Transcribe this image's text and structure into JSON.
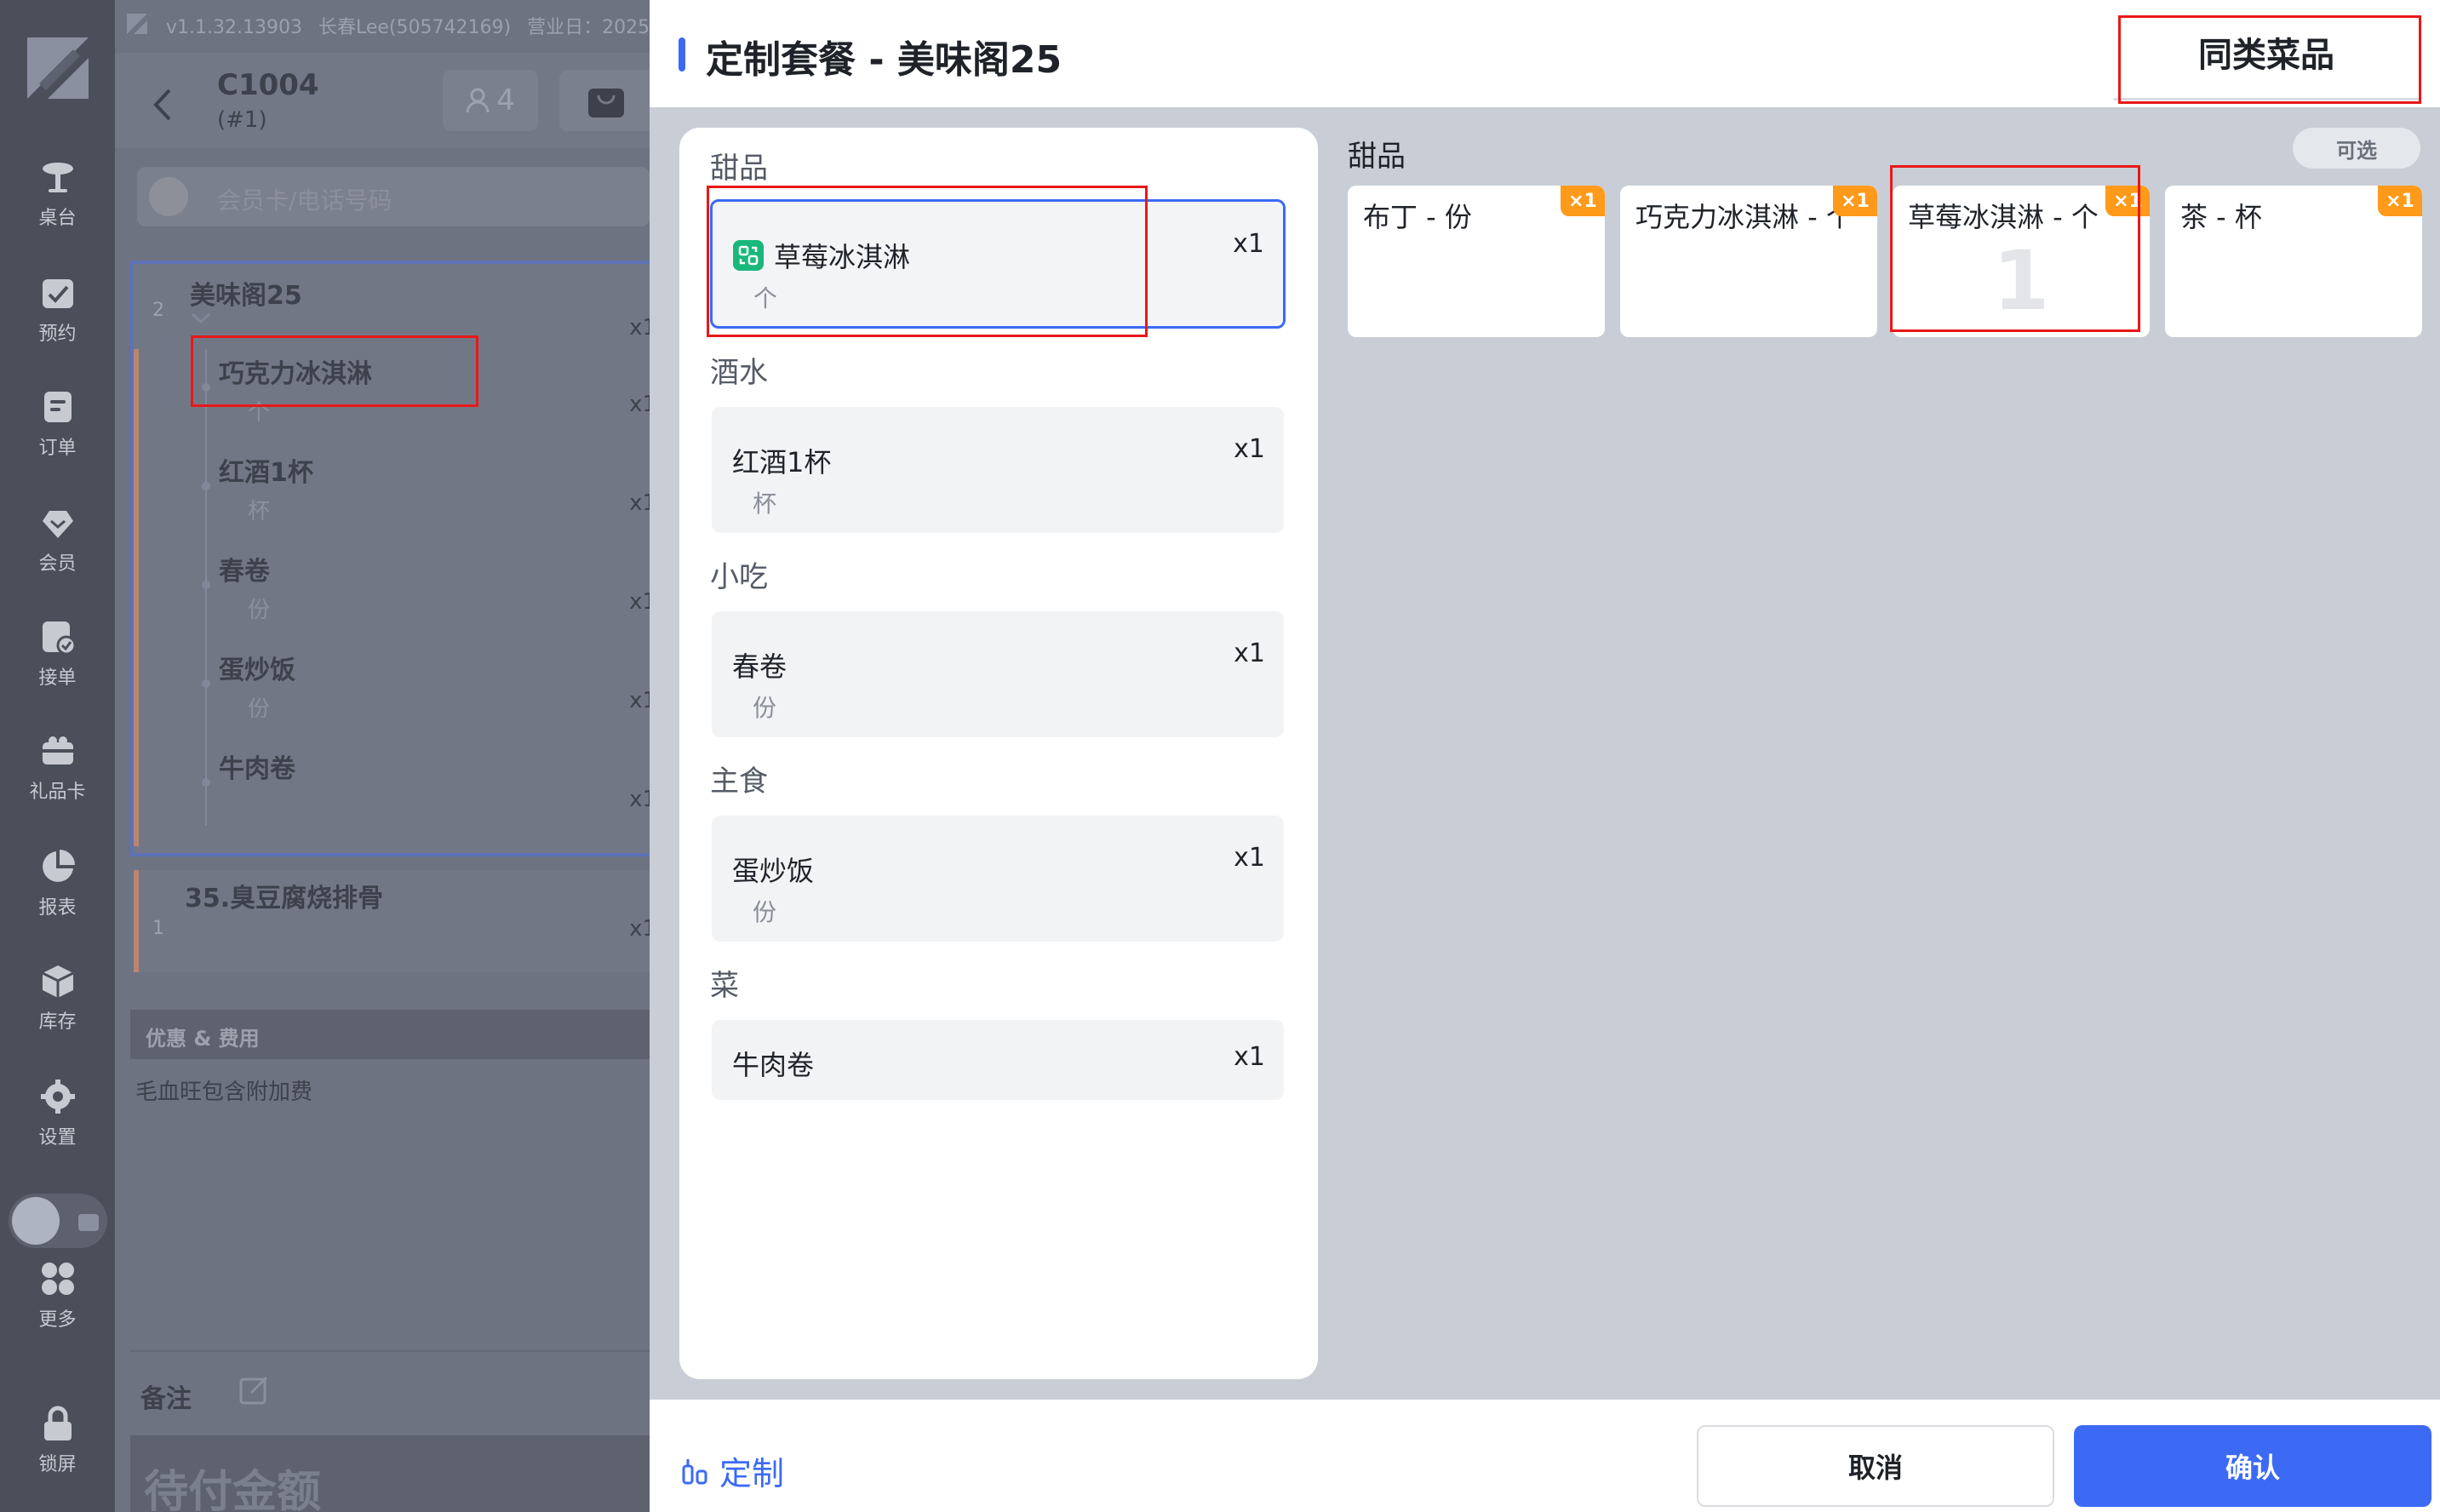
{
  "app": {
    "version": "v1.1.32.13903",
    "user": "长春Lee(505742169)",
    "business_day_label": "营业日：2025"
  },
  "nav": [
    {
      "label": "桌台",
      "icon": "table-icon"
    },
    {
      "label": "预约",
      "icon": "reservation-icon"
    },
    {
      "label": "订单",
      "icon": "order-icon"
    },
    {
      "label": "会员",
      "icon": "member-icon"
    },
    {
      "label": "接单",
      "icon": "accept-order-icon"
    },
    {
      "label": "礼品卡",
      "icon": "gift-card-icon"
    },
    {
      "label": "报表",
      "icon": "report-icon"
    },
    {
      "label": "库存",
      "icon": "inventory-icon"
    },
    {
      "label": "设置",
      "icon": "settings-icon"
    },
    {
      "label": "更多",
      "icon": "more-icon"
    },
    {
      "label": "锁屏",
      "icon": "lock-icon"
    }
  ],
  "order": {
    "table_no": "C1004",
    "table_sub": "(#1)",
    "guests": "4",
    "member_placeholder": "会员卡/电话号码",
    "combo": {
      "count": "2",
      "title": "美味阁25",
      "qty": "x1",
      "items": [
        {
          "name": "巧克力冰淇淋",
          "unit": "个",
          "qty": "x1"
        },
        {
          "name": "红酒1杯",
          "unit": "杯",
          "qty": "x1"
        },
        {
          "name": "春卷",
          "unit": "份",
          "qty": "x1"
        },
        {
          "name": "蛋炒饭",
          "unit": "份",
          "qty": "x1"
        },
        {
          "name": "牛肉卷",
          "unit": "",
          "qty": "x1"
        }
      ]
    },
    "item2": {
      "count": "1",
      "name": "35.臭豆腐烧排骨",
      "qty": "x1"
    },
    "discount_label": "优惠 & 费用",
    "surcharge": "毛血旺包含附加费",
    "remark_label": "备注",
    "pay_label": "待付金额"
  },
  "modal": {
    "title": "定制套餐 - 美味阁25",
    "similar_button": "同类菜品",
    "groups": [
      {
        "title": "甜品",
        "dish": {
          "name": "草莓冰淇淋",
          "unit": "个",
          "qty": "x1"
        }
      },
      {
        "title": "酒水",
        "dish": {
          "name": "红酒1杯",
          "unit": "杯",
          "qty": "x1"
        }
      },
      {
        "title": "小吃",
        "dish": {
          "name": "春卷",
          "unit": "份",
          "qty": "x1"
        }
      },
      {
        "title": "主食",
        "dish": {
          "name": "蛋炒饭",
          "unit": "份",
          "qty": "x1"
        }
      },
      {
        "title": "菜",
        "dish": {
          "name": "牛肉卷",
          "unit": "",
          "qty": "x1"
        }
      }
    ],
    "right_title": "甜品",
    "optional_tag": "可选",
    "options": [
      {
        "name": "布丁 - 份",
        "badge": "×1",
        "selected_count": ""
      },
      {
        "name": "巧克力冰淇淋 - 个",
        "badge": "×1",
        "selected_count": ""
      },
      {
        "name": "草莓冰淇淋 - 个",
        "badge": "×1",
        "selected_count": "1"
      },
      {
        "name": "茶 - 杯",
        "badge": "×1",
        "selected_count": ""
      }
    ],
    "custom_link": "定制",
    "cancel": "取消",
    "confirm": "确认"
  }
}
